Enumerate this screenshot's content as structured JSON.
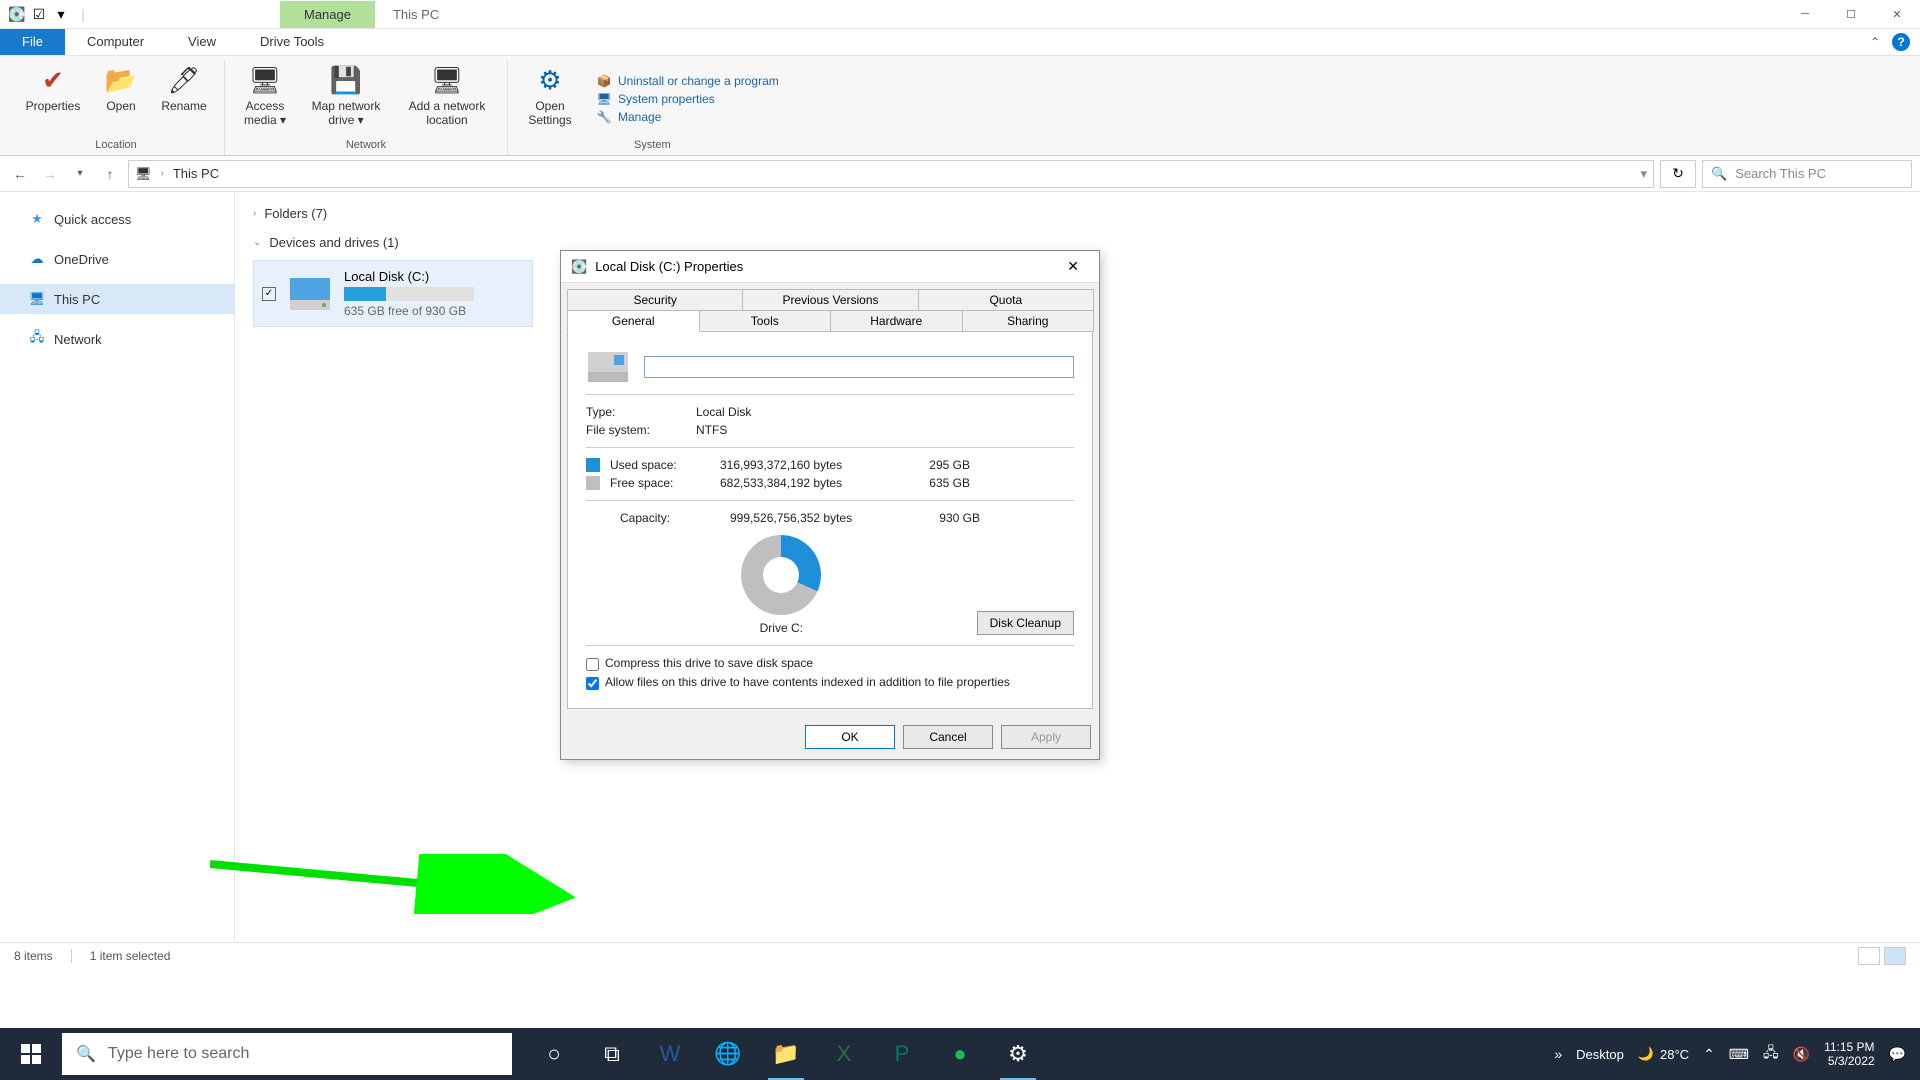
{
  "titlebar": {
    "tab_manage": "Manage",
    "tab_location": "This PC"
  },
  "ribbon_tabs": {
    "file": "File",
    "computer": "Computer",
    "view": "View",
    "drive_tools": "Drive Tools"
  },
  "ribbon": {
    "location": {
      "properties": "Properties",
      "open": "Open",
      "rename": "Rename",
      "group_label": "Location"
    },
    "network": {
      "access_media": "Access media ▾",
      "map_drive": "Map network drive ▾",
      "add_loc": "Add a network location",
      "group_label": "Network"
    },
    "system": {
      "open_settings": "Open Settings",
      "uninstall": "Uninstall or change a program",
      "sys_props": "System properties",
      "manage": "Manage",
      "group_label": "System"
    }
  },
  "address": {
    "location": "This PC",
    "search_placeholder": "Search This PC"
  },
  "sidebar": {
    "items": [
      {
        "label": "Quick access",
        "icon": "★",
        "color": "#3b9ae1"
      },
      {
        "label": "OneDrive",
        "icon": "☁",
        "color": "#0078d4"
      },
      {
        "label": "This PC",
        "icon": "🖥",
        "color": "#0078d4"
      },
      {
        "label": "Network",
        "icon": "🖧",
        "color": "#0078d4"
      }
    ]
  },
  "content": {
    "folders": "Folders (7)",
    "devices": "Devices and drives (1)",
    "drive_name": "Local Disk (C:)",
    "drive_free": "635 GB free of 930 GB"
  },
  "dialog": {
    "title": "Local Disk (C:) Properties",
    "tabs_top": [
      "Security",
      "Previous Versions",
      "Quota"
    ],
    "tabs_bot": [
      "General",
      "Tools",
      "Hardware",
      "Sharing"
    ],
    "type_label": "Type:",
    "type_value": "Local Disk",
    "fs_label": "File system:",
    "fs_value": "NTFS",
    "used_label": "Used space:",
    "used_bytes": "316,993,372,160 bytes",
    "used_h": "295 GB",
    "free_label": "Free space:",
    "free_bytes": "682,533,384,192 bytes",
    "free_h": "635 GB",
    "cap_label": "Capacity:",
    "cap_bytes": "999,526,756,352 bytes",
    "cap_h": "930 GB",
    "drive_label": "Drive C:",
    "cleanup": "Disk Cleanup",
    "compress": "Compress this drive to save disk space",
    "index": "Allow files on this drive to have contents indexed in addition to file properties",
    "ok": "OK",
    "cancel": "Cancel",
    "apply": "Apply"
  },
  "statusbar": {
    "items": "8 items",
    "selected": "1 item selected"
  },
  "taskbar": {
    "search": "Type here to search",
    "desktop": "Desktop",
    "temp": "28°C",
    "time": "11:15 PM",
    "date": "5/3/2022"
  }
}
